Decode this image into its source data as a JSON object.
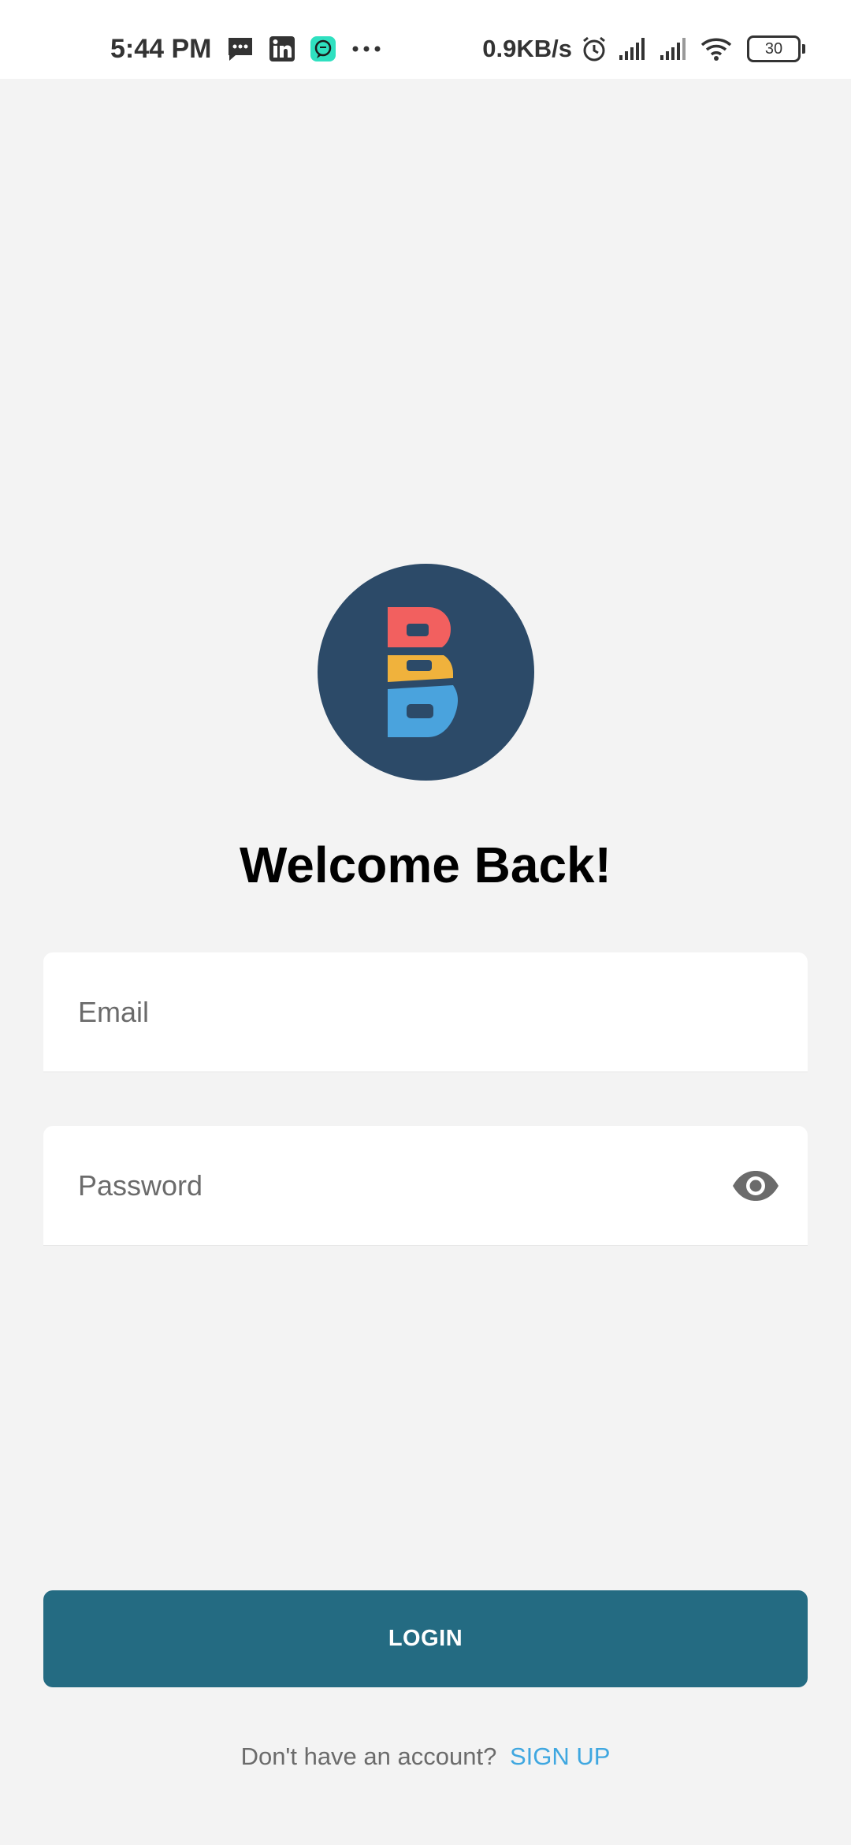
{
  "status_bar": {
    "time": "5:44 PM",
    "network_speed": "0.9KB/s",
    "battery_level": "30",
    "left_icons": [
      "message-icon",
      "linkedin-icon",
      "app-icon",
      "more-icon"
    ],
    "right_icons": [
      "alarm-icon",
      "signal-icon",
      "signal-icon",
      "wifi-icon",
      "battery-icon"
    ]
  },
  "logo": {
    "letters": "BBB",
    "colors": {
      "background": "#2c4a68",
      "top": "#f2605f",
      "middle": "#f0b23c",
      "bottom": "#4aa3dd"
    }
  },
  "welcome_title": "Welcome Back!",
  "email": {
    "placeholder": "Email",
    "value": ""
  },
  "password": {
    "placeholder": "Password",
    "value": ""
  },
  "login_button": {
    "label": "LOGIN",
    "color": "#246b82"
  },
  "signup": {
    "prompt": "Don't have an account?",
    "link": "SIGN UP",
    "link_color": "#3fa7e0"
  }
}
